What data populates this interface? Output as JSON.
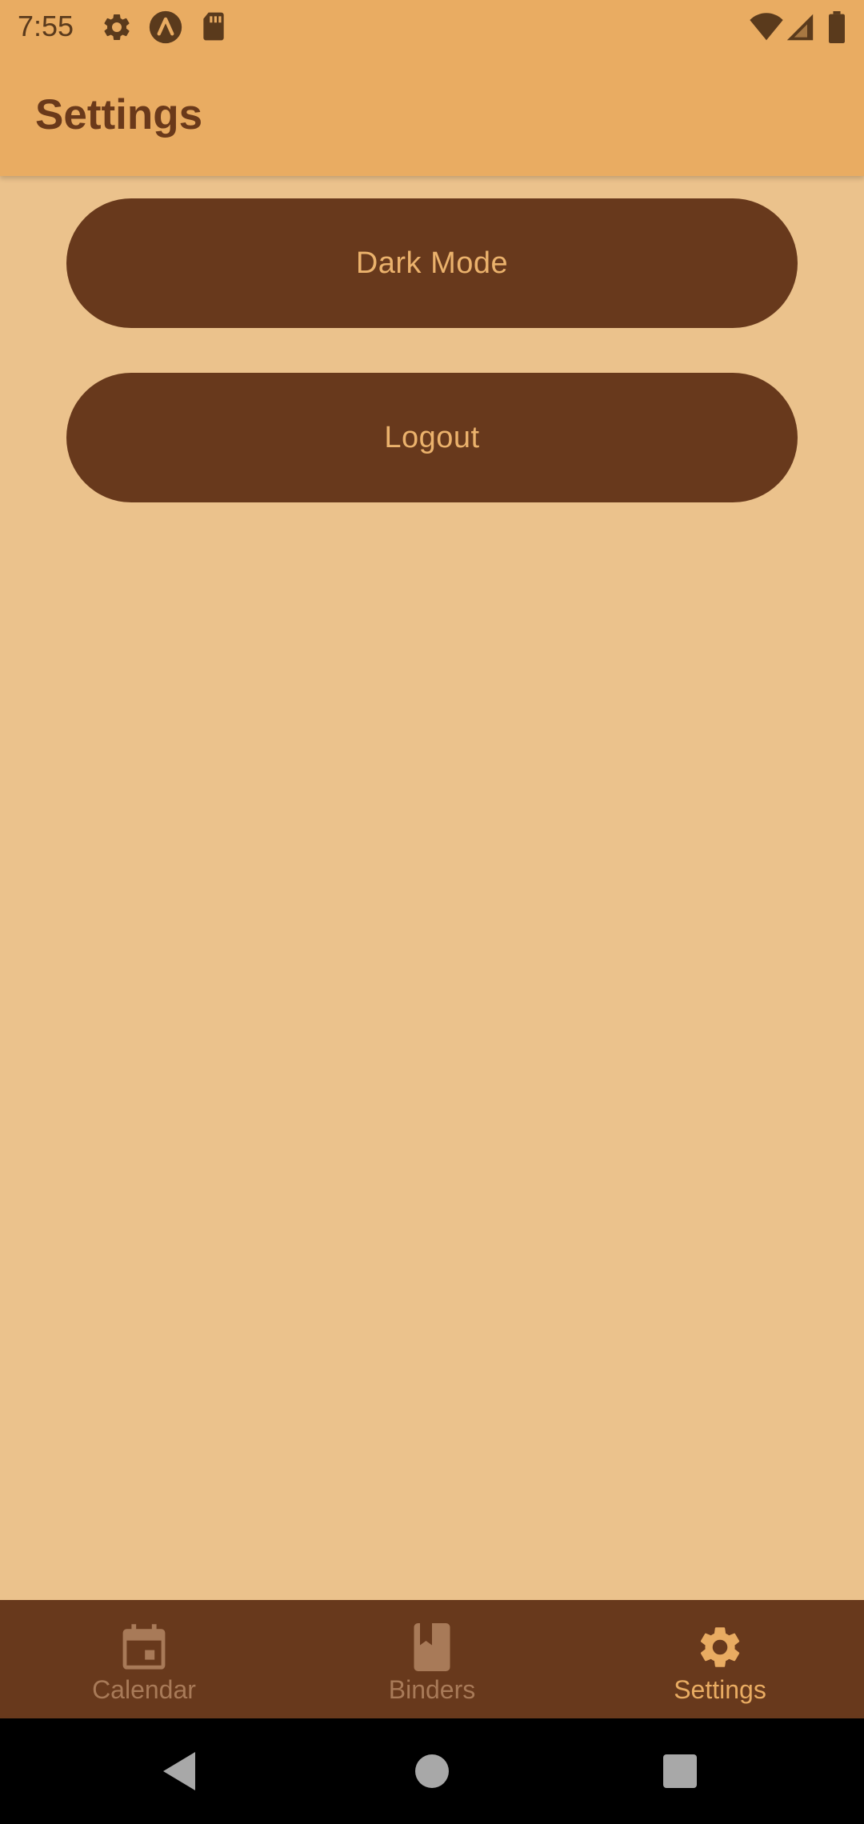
{
  "status_bar": {
    "time": "7:55",
    "left_icons": [
      "gear-icon",
      "a-circle-icon",
      "sd-card-icon"
    ],
    "right_icons": [
      "wifi-icon",
      "signal-icon",
      "battery-icon"
    ]
  },
  "app_bar": {
    "title": "Settings"
  },
  "settings": {
    "dark_mode_label": "Dark Mode",
    "logout_label": "Logout"
  },
  "bottom_nav": {
    "items": [
      {
        "label": "Calendar",
        "icon": "calendar-icon",
        "active": false
      },
      {
        "label": "Binders",
        "icon": "book-icon",
        "active": false
      },
      {
        "label": "Settings",
        "icon": "gear-icon",
        "active": true
      }
    ]
  },
  "system_nav": {
    "buttons": [
      "back-icon",
      "home-icon",
      "recents-icon"
    ]
  },
  "colors": {
    "header": "#E9AC62",
    "background": "#EBC28C",
    "primary_dark": "#68391C",
    "accent": "#E9AC62",
    "inactive_nav": "#A87A58"
  }
}
